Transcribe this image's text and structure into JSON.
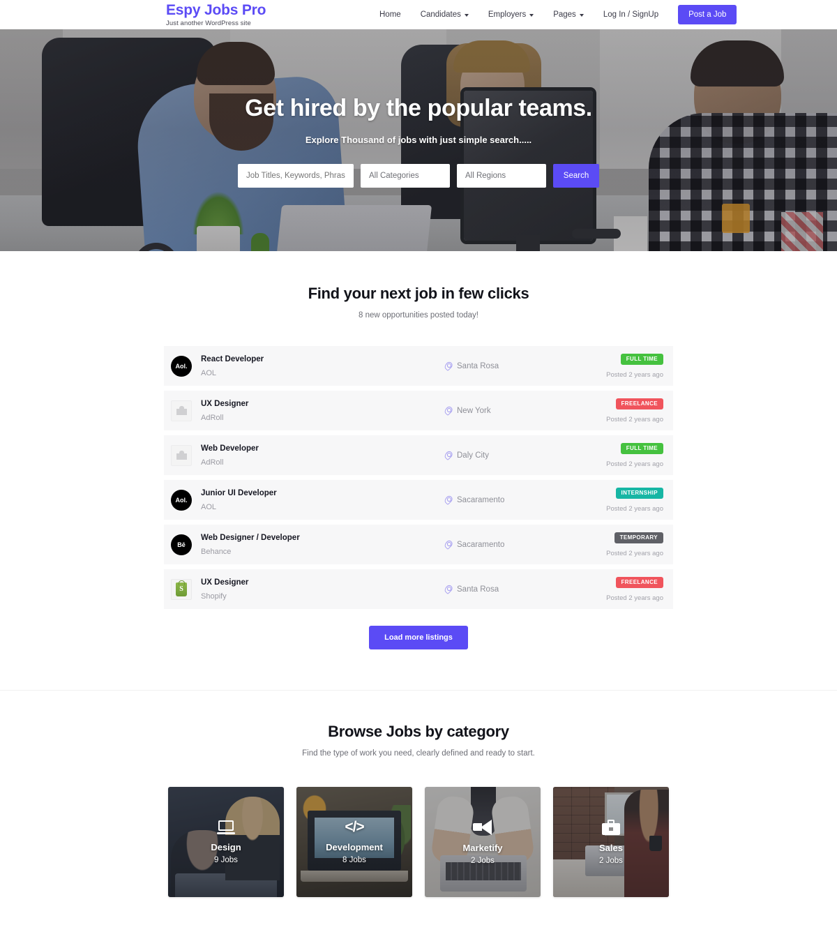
{
  "header": {
    "brand_title": "Espy Jobs Pro",
    "brand_tagline": "Just another WordPress site",
    "nav": [
      {
        "label": "Home",
        "has_caret": false
      },
      {
        "label": "Candidates",
        "has_caret": true
      },
      {
        "label": "Employers",
        "has_caret": true
      },
      {
        "label": "Pages",
        "has_caret": true
      },
      {
        "label": "Log In / SignUp",
        "has_caret": false
      }
    ],
    "post_job_label": "Post a Job",
    "brand_color": "#5b4bf5"
  },
  "hero": {
    "title": "Get hired by the popular teams.",
    "subtitle": "Explore Thousand of jobs with just simple search.....",
    "search": {
      "keyword_placeholder": "Job Titles, Keywords, Phrase",
      "keyword_value": "",
      "category_value": "All Categories",
      "region_value": "All Regions",
      "search_label": "Search"
    }
  },
  "jobs_section": {
    "title": "Find your next job in few clicks",
    "subtitle": "8 new opportunities posted today!",
    "load_more_label": "Load more listings",
    "listings": [
      {
        "title": "React Developer",
        "company": "AOL",
        "logo": "aol-logo",
        "logo_text": "Aol.",
        "location": "Santa Rosa",
        "badge": "FULL TIME",
        "badge_color": "#45c13f",
        "posted": "Posted 2 years ago"
      },
      {
        "title": "UX Designer",
        "company": "AdRoll",
        "logo": "placeholder-logo",
        "logo_text": "",
        "location": "New York",
        "badge": "FREELANCE",
        "badge_color": "#f0545c",
        "posted": "Posted 2 years ago"
      },
      {
        "title": "Web Developer",
        "company": "AdRoll",
        "logo": "placeholder-logo",
        "logo_text": "",
        "location": "Daly City",
        "badge": "FULL TIME",
        "badge_color": "#45c13f",
        "posted": "Posted 2 years ago"
      },
      {
        "title": "Junior UI Developer",
        "company": "AOL",
        "logo": "aol-logo",
        "logo_text": "Aol.",
        "location": "Sacaramento",
        "badge": "INTERNSHIP",
        "badge_color": "#17b6a4",
        "posted": "Posted 2 years ago"
      },
      {
        "title": "Web Designer / Developer",
        "company": "Behance",
        "logo": "behance-logo",
        "logo_text": "Bē",
        "location": "Sacaramento",
        "badge": "TEMPORARY",
        "badge_color": "#5f6066",
        "posted": "Posted 2 years ago"
      },
      {
        "title": "UX Designer",
        "company": "Shopify",
        "logo": "shopify-logo",
        "logo_text": "S",
        "location": "Santa Rosa",
        "badge": "FREELANCE",
        "badge_color": "#f0545c",
        "posted": "Posted 2 years ago"
      }
    ]
  },
  "categories_section": {
    "title": "Browse Jobs by category",
    "subtitle": "Find the type of work you need, clearly defined and ready to start.",
    "cards": [
      {
        "name": "Design",
        "count": "9 Jobs",
        "icon": "laptop-icon"
      },
      {
        "name": "Development",
        "count": "8 Jobs",
        "icon": "code-icon"
      },
      {
        "name": "Marketify",
        "count": "2 Jobs",
        "icon": "megaphone-icon"
      },
      {
        "name": "Sales",
        "count": "2 Jobs",
        "icon": "briefcase-icon"
      }
    ]
  }
}
